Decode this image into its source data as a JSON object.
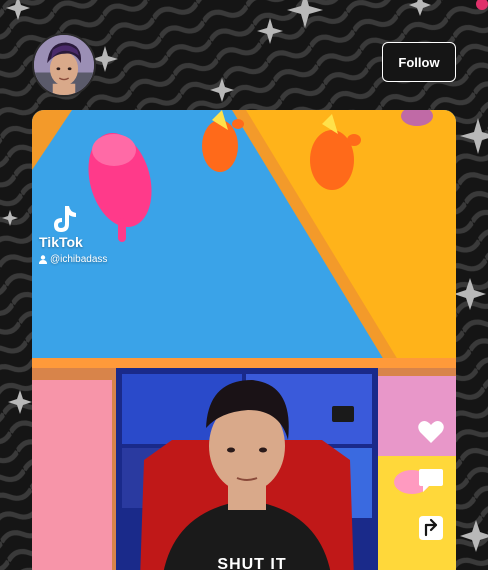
{
  "header": {
    "avatar_icon": "user-avatar",
    "follow_label": "Follow"
  },
  "video": {
    "watermark_brand": "TikTok",
    "watermark_handle": "@ichibadass",
    "shirt_text": "SHUT IT"
  },
  "actions": [
    {
      "name": "like",
      "icon": "heart-icon"
    },
    {
      "name": "comment",
      "icon": "comment-icon"
    },
    {
      "name": "share",
      "icon": "share-icon"
    }
  ],
  "colors": {
    "background": "#151515",
    "follow_border": "#ffffff",
    "sparkle": "#9a9a9a",
    "sky_blue": "#3aa3e8",
    "track_yellow": "#ffb31a"
  }
}
